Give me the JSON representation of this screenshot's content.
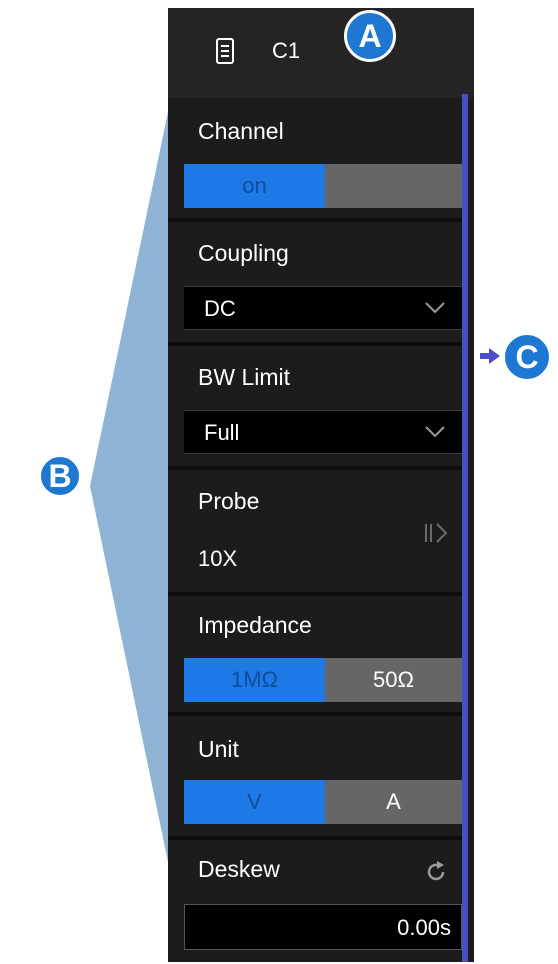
{
  "header": {
    "title": "C1"
  },
  "callouts": {
    "a": "A",
    "b": "B",
    "c": "C"
  },
  "channel": {
    "label": "Channel",
    "on_label": "on",
    "off_label": ""
  },
  "coupling": {
    "label": "Coupling",
    "value": "DC"
  },
  "bw_limit": {
    "label": "BW Limit",
    "value": "Full"
  },
  "probe": {
    "label": "Probe",
    "value": "10X"
  },
  "impedance": {
    "label": "Impedance",
    "options": [
      "1MΩ",
      "50Ω"
    ],
    "selected": "1MΩ"
  },
  "unit": {
    "label": "Unit",
    "options": [
      "V",
      "A"
    ],
    "selected": "V"
  },
  "deskew": {
    "label": "Deskew",
    "value": "0.00s"
  },
  "icons": [
    "document-icon",
    "chevron-down-icon",
    "probe-arrow-icon",
    "reset-icon"
  ],
  "colors": {
    "panel": "#1c1c1c",
    "accent": "#1e78e6",
    "inactive": "#666666",
    "scrollbar": "#4a4fc8",
    "callout": "#1e78d2"
  }
}
